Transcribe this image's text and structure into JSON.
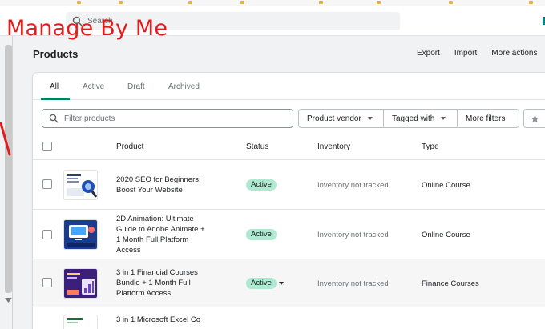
{
  "search": {
    "placeholder": "Search"
  },
  "watermark": "Manage By Me",
  "page": {
    "title": "Products",
    "actions": [
      "Export",
      "Import",
      "More actions"
    ]
  },
  "tabs": [
    {
      "label": "All",
      "active": true
    },
    {
      "label": "Active",
      "active": false
    },
    {
      "label": "Draft",
      "active": false
    },
    {
      "label": "Archived",
      "active": false
    }
  ],
  "filters": {
    "placeholder": "Filter products",
    "buttons": [
      "Product vendor",
      "Tagged with",
      "More filters"
    ]
  },
  "columns": [
    "Product",
    "Status",
    "Inventory",
    "Type"
  ],
  "products": [
    {
      "name": "2020 SEO for Beginners: Boost Your Website",
      "status": "Active",
      "inventory": "Inventory not tracked",
      "type": "Online Course"
    },
    {
      "name": "2D Animation: Ultimate Guide to Adobe Animate + 1 Month Full Platform Access",
      "status": "Active",
      "inventory": "Inventory not tracked",
      "type": "Online Course"
    },
    {
      "name": "3 in 1 Financial Courses Bundle + 1 Month Full Platform Access",
      "status": "Active",
      "inventory": "Inventory not tracked",
      "type": "Finance Courses"
    },
    {
      "name": "3 in 1 Microsoft Excel Co",
      "status": "",
      "inventory": "",
      "type": ""
    }
  ],
  "colors": {
    "accent": "#008060",
    "badge_active": "#aee9d1",
    "watermark": "#e31b1b"
  }
}
